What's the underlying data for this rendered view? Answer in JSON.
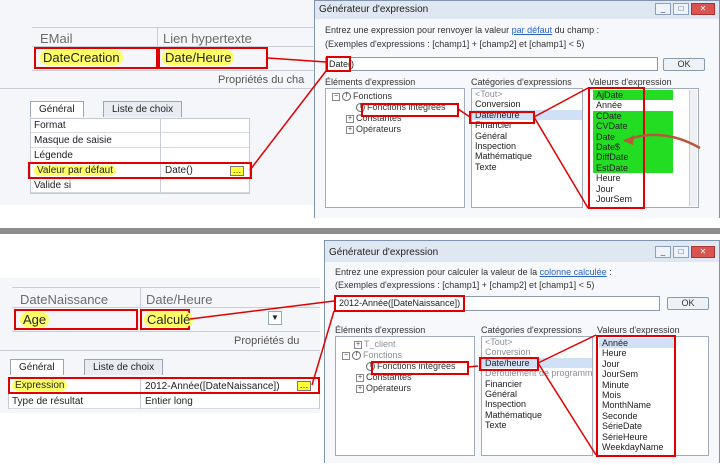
{
  "top": {
    "table_header": {
      "col1": "EMail",
      "col2": "Lien hypertexte"
    },
    "row": {
      "field": "DateCreation",
      "type": "Date/Heure"
    },
    "properties_title": "Propriétés du cha",
    "tabs": [
      "Général",
      "Liste de choix"
    ],
    "props": [
      "Format",
      "Masque de saisie",
      "Légende",
      "Valeur par défaut",
      "Valide si"
    ],
    "default_value": "Date()",
    "builder": {
      "title": "Générateur d'expression",
      "instruction_pre": "Entrez une expression pour renvoyer la valeur ",
      "instruction_link": "par défaut",
      "instruction_post": " du champ :",
      "examples": "(Exemples d'expressions : [champ1] + [champ2] et [champ1] < 5)",
      "expression": "Date()",
      "ok": "OK",
      "elements_label": "Éléments d'expression",
      "categories_label": "Catégories d'expressions",
      "values_label": "Valeurs d'expression",
      "tree": [
        "Fonctions",
        "Fonctions intégrées",
        "Constantes",
        "Opérateurs"
      ],
      "categories": [
        "<Tout>",
        "Conversion",
        "Date/heure",
        "Financier",
        "Général",
        "Inspection",
        "Mathématique",
        "Texte"
      ],
      "values": [
        "AjDate",
        "Année",
        "CDate",
        "CVDate",
        "Date",
        "Date$",
        "DiffDate",
        "EstDate",
        "Heure",
        "Jour",
        "JourSem"
      ]
    }
  },
  "bottom": {
    "table_header": {
      "col1": "DateNaissance",
      "col2": "Date/Heure"
    },
    "row": {
      "field": "Age",
      "type": "Calculé"
    },
    "properties_title": "Propriétés du",
    "tabs": [
      "Général",
      "Liste de choix"
    ],
    "props": [
      "Expression",
      "Type de résultat"
    ],
    "expression_value": "2012-Année([DateNaissance])",
    "result_type": "Entier long",
    "builder": {
      "title": "Générateur d'expression",
      "instruction_pre": "Entrez une expression pour calculer la valeur de la ",
      "instruction_link": "colonne calculée",
      "instruction_post": " :",
      "examples": "(Exemples d'expressions : [champ1] + [champ2] et [champ1] < 5)",
      "expression": "2012-Année([DateNaissance])",
      "ok": "OK",
      "elements_label": "Éléments d'expression",
      "categories_label": "Catégories d'expressions",
      "values_label": "Valeurs d'expression",
      "tree": [
        "T_client",
        "Fonctions",
        "Fonctions intégrées",
        "Constantes",
        "Opérateurs"
      ],
      "categories": [
        "<Tout>",
        "Conversion",
        "Date/heure",
        "Financier",
        "Général",
        "Inspection",
        "Mathématique",
        "Texte"
      ],
      "hidden_category": "Déroulement de programme",
      "values": [
        "Année",
        "Heure",
        "Jour",
        "JourSem",
        "Minute",
        "Mois",
        "MonthName",
        "Seconde",
        "SérieDate",
        "SérieHeure",
        "WeekdayName"
      ]
    }
  },
  "colors": {
    "highlight": "#ffff66",
    "box": "#e00000",
    "green": "#22dd22",
    "arrow": "#b35a3a"
  }
}
